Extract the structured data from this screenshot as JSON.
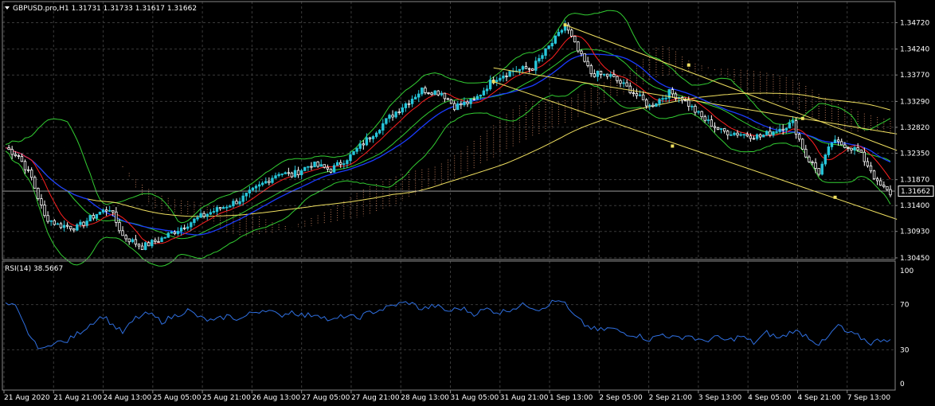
{
  "window": {
    "title": "GBPUSD.pro,H1  1.31731 1.31733 1.31617 1.31662",
    "menu_icon": "triangle-down-icon"
  },
  "price_axis": {
    "ticks": [
      "1.34720",
      "1.34240",
      "1.33770",
      "1.33290",
      "1.32820",
      "1.32350",
      "1.31870",
      "1.31400",
      "1.30930",
      "1.30450"
    ],
    "current_price": "1.31662"
  },
  "rsi": {
    "label": "RSI(14) 38.5667",
    "ticks": [
      "100",
      "70",
      "30",
      "0"
    ]
  },
  "time_axis": {
    "labels": [
      "21 Aug 2020",
      "21 Aug 21:00",
      "24 Aug 13:00",
      "25 Aug 05:00",
      "25 Aug 21:00",
      "26 Aug 13:00",
      "27 Aug 05:00",
      "27 Aug 21:00",
      "28 Aug 13:00",
      "31 Aug 05:00",
      "31 Aug 21:00",
      "1 Sep 13:00",
      "2 Sep 05:00",
      "2 Sep 21:00",
      "3 Sep 13:00",
      "4 Sep 05:00",
      "4 Sep 21:00",
      "7 Sep 13:00"
    ]
  },
  "colors": {
    "background": "#000000",
    "grid": "#3a3a3a",
    "bull": "#26c6da",
    "bear": "#ffffff",
    "upper_band": "#32cd32",
    "signal_red": "#ff2020",
    "signal_blue": "#1a3cff",
    "ma_yellow": "#f0e060",
    "cloud": "#d98c66",
    "rsi": "#2f6fe0",
    "channel": "#f0e060"
  },
  "chart_data": {
    "type": "candlestick",
    "symbol": "GBPUSD.pro",
    "timeframe": "H1",
    "last": {
      "open": 1.31731,
      "high": 1.31733,
      "low": 1.31617,
      "close": 1.31662
    },
    "ylim": [
      1.3042,
      1.349
    ],
    "close_path": [
      [
        0,
        1.3245
      ],
      [
        4,
        1.323
      ],
      [
        8,
        1.319
      ],
      [
        12,
        1.312
      ],
      [
        16,
        1.3105
      ],
      [
        22,
        1.31
      ],
      [
        28,
        1.3125
      ],
      [
        32,
        1.3135
      ],
      [
        36,
        1.3085
      ],
      [
        42,
        1.3065
      ],
      [
        48,
        1.308
      ],
      [
        54,
        1.31
      ],
      [
        60,
        1.312
      ],
      [
        66,
        1.3135
      ],
      [
        72,
        1.315
      ],
      [
        78,
        1.3175
      ],
      [
        84,
        1.32
      ],
      [
        88,
        1.3195
      ],
      [
        94,
        1.3215
      ],
      [
        100,
        1.3205
      ],
      [
        106,
        1.323
      ],
      [
        112,
        1.3265
      ],
      [
        118,
        1.33
      ],
      [
        124,
        1.333
      ],
      [
        128,
        1.335
      ],
      [
        134,
        1.3345
      ],
      [
        138,
        1.332
      ],
      [
        144,
        1.333
      ],
      [
        150,
        1.337
      ],
      [
        156,
        1.3385
      ],
      [
        162,
        1.339
      ],
      [
        166,
        1.342
      ],
      [
        170,
        1.345
      ],
      [
        172,
        1.3468
      ],
      [
        176,
        1.342
      ],
      [
        180,
        1.338
      ],
      [
        186,
        1.3375
      ],
      [
        192,
        1.335
      ],
      [
        198,
        1.332
      ],
      [
        204,
        1.3345
      ],
      [
        208,
        1.3335
      ],
      [
        214,
        1.33
      ],
      [
        220,
        1.3275
      ],
      [
        226,
        1.327
      ],
      [
        232,
        1.3265
      ],
      [
        238,
        1.328
      ],
      [
        242,
        1.329
      ],
      [
        246,
        1.323
      ],
      [
        250,
        1.32
      ],
      [
        254,
        1.3255
      ],
      [
        258,
        1.325
      ],
      [
        262,
        1.324
      ],
      [
        266,
        1.3205
      ],
      [
        268,
        1.318
      ],
      [
        272,
        1.3162
      ]
    ],
    "rsi_path": [
      [
        0,
        70
      ],
      [
        3,
        68
      ],
      [
        6,
        50
      ],
      [
        9,
        35
      ],
      [
        12,
        30
      ],
      [
        15,
        38
      ],
      [
        18,
        36
      ],
      [
        21,
        42
      ],
      [
        24,
        48
      ],
      [
        27,
        55
      ],
      [
        30,
        60
      ],
      [
        33,
        52
      ],
      [
        36,
        45
      ],
      [
        40,
        58
      ],
      [
        44,
        62
      ],
      [
        48,
        55
      ],
      [
        52,
        60
      ],
      [
        56,
        65
      ],
      [
        60,
        58
      ],
      [
        64,
        55
      ],
      [
        68,
        60
      ],
      [
        72,
        57
      ],
      [
        76,
        63
      ],
      [
        80,
        66
      ],
      [
        84,
        60
      ],
      [
        88,
        64
      ],
      [
        92,
        60
      ],
      [
        96,
        62
      ],
      [
        100,
        55
      ],
      [
        104,
        60
      ],
      [
        108,
        58
      ],
      [
        112,
        63
      ],
      [
        116,
        66
      ],
      [
        120,
        70
      ],
      [
        124,
        72
      ],
      [
        128,
        66
      ],
      [
        132,
        69
      ],
      [
        136,
        64
      ],
      [
        140,
        67
      ],
      [
        144,
        62
      ],
      [
        148,
        66
      ],
      [
        152,
        63
      ],
      [
        156,
        67
      ],
      [
        160,
        70
      ],
      [
        164,
        66
      ],
      [
        168,
        72
      ],
      [
        171,
        74
      ],
      [
        174,
        62
      ],
      [
        178,
        52
      ],
      [
        182,
        47
      ],
      [
        186,
        49
      ],
      [
        190,
        45
      ],
      [
        194,
        43
      ],
      [
        198,
        39
      ],
      [
        202,
        44
      ],
      [
        206,
        40
      ],
      [
        210,
        43
      ],
      [
        214,
        37
      ],
      [
        218,
        41
      ],
      [
        222,
        38
      ],
      [
        226,
        42
      ],
      [
        230,
        36
      ],
      [
        234,
        45
      ],
      [
        238,
        40
      ],
      [
        242,
        47
      ],
      [
        246,
        43
      ],
      [
        250,
        35
      ],
      [
        252,
        38
      ],
      [
        256,
        52
      ],
      [
        258,
        46
      ],
      [
        262,
        42
      ],
      [
        266,
        36
      ],
      [
        270,
        40
      ],
      [
        272,
        38.57
      ]
    ],
    "series": [
      {
        "name": "Bollinger upper/lower",
        "color": "upper_band"
      },
      {
        "name": "Signal line",
        "color": "signal_red"
      },
      {
        "name": "Baseline",
        "color": "signal_blue"
      },
      {
        "name": "Moving average",
        "color": "ma_yellow"
      },
      {
        "name": "Ichimoku cloud",
        "color": "cloud"
      },
      {
        "name": "RSI(14)",
        "color": "rsi",
        "value": 38.5667
      }
    ]
  }
}
